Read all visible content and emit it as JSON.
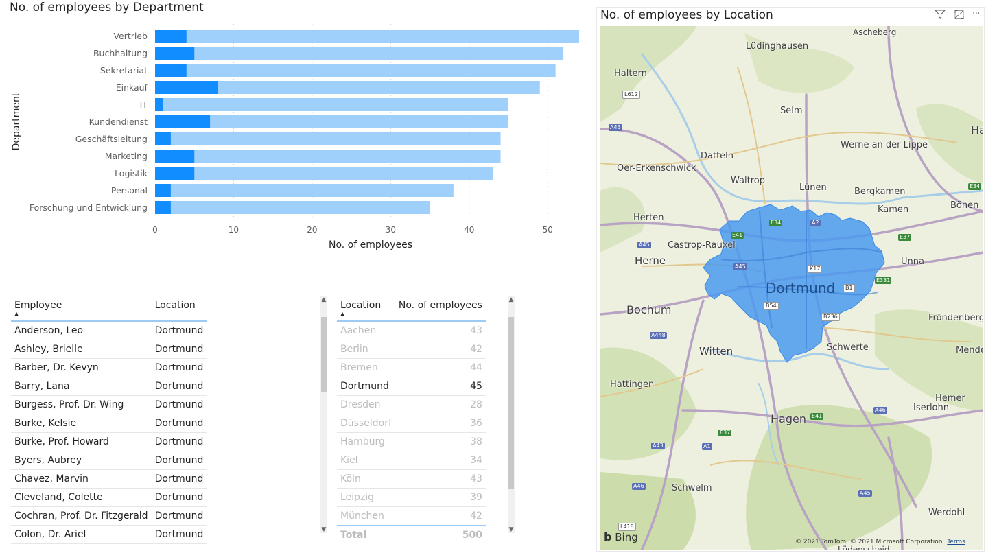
{
  "bar_visual": {
    "title": "No. of employees by Department"
  },
  "chart_data": {
    "type": "bar",
    "orientation": "horizontal",
    "title": "No. of employees by Department",
    "xlabel": "No. of employees",
    "ylabel": "Department",
    "xlim": [
      0,
      55
    ],
    "x_ticks": [
      "0",
      "10",
      "20",
      "30",
      "40",
      "50"
    ],
    "grid": true,
    "categories": [
      "Vertrieb",
      "Buchhaltung",
      "Sekretariat",
      "Einkauf",
      "IT",
      "Kundendienst",
      "Geschäftsleitung",
      "Marketing",
      "Logistik",
      "Personal",
      "Forschung und Entwicklung"
    ],
    "series": [
      {
        "values": [
          54,
          52,
          51,
          49,
          45,
          45,
          44,
          44,
          43,
          38,
          35
        ],
        "color": "#9fd0fc"
      },
      {
        "values": [
          4,
          5,
          4,
          8,
          1,
          7,
          2,
          5,
          5,
          2,
          2
        ],
        "color": "#118dff"
      }
    ]
  },
  "employee_table": {
    "headers": {
      "employee": "Employee",
      "location": "Location"
    },
    "sort_arrow": "▲",
    "rows": [
      [
        "Anderson, Leo",
        "Dortmund"
      ],
      [
        "Ashley, Brielle",
        "Dortmund"
      ],
      [
        "Barber, Dr. Kevyn",
        "Dortmund"
      ],
      [
        "Barry, Lana",
        "Dortmund"
      ],
      [
        "Burgess, Prof. Dr. Wing",
        "Dortmund"
      ],
      [
        "Burke, Kelsie",
        "Dortmund"
      ],
      [
        "Burke, Prof. Howard",
        "Dortmund"
      ],
      [
        "Byers, Aubrey",
        "Dortmund"
      ],
      [
        "Chavez, Marvin",
        "Dortmund"
      ],
      [
        "Cleveland, Colette",
        "Dortmund"
      ],
      [
        "Cochran, Prof. Dr. Fitzgerald",
        "Dortmund"
      ],
      [
        "Colon, Dr. Ariel",
        "Dortmund"
      ]
    ]
  },
  "location_table": {
    "headers": {
      "location": "Location",
      "count": "No. of employees"
    },
    "sort_arrow": "▲",
    "rows": [
      [
        "Aachen",
        "43",
        false
      ],
      [
        "Berlin",
        "42",
        false
      ],
      [
        "Bremen",
        "44",
        false
      ],
      [
        "Dortmund",
        "45",
        true
      ],
      [
        "Dresden",
        "28",
        false
      ],
      [
        "Düsseldorf",
        "36",
        false
      ],
      [
        "Hamburg",
        "38",
        false
      ],
      [
        "Kiel",
        "34",
        false
      ],
      [
        "Köln",
        "43",
        false
      ],
      [
        "Leipzig",
        "39",
        false
      ],
      [
        "München",
        "42",
        false
      ]
    ],
    "total_label": "Total",
    "total_value": "500"
  },
  "map_visual": {
    "title": "No. of employees by Location",
    "selected_city": "Dortmund",
    "highlight_color": "#4a9af0",
    "places": [
      "Ascheberg",
      "Lüdinghausen",
      "Haltern",
      "Selm",
      "Werne an der Lippe",
      "Datteln",
      "Oer-Erkenschwick",
      "Waltrop",
      "Lünen",
      "Bergkamen",
      "Bönen",
      "Kamen",
      "Herten",
      "Castrop-Rauxel",
      "Herne",
      "Unna",
      "Bochum",
      "Fröndenberg",
      "Witten",
      "Schwerte",
      "Mende",
      "Hattingen",
      "Hemer",
      "Iserlohn",
      "Hagen",
      "Schwelm",
      "Werdohl",
      "Ha",
      "Lüdenscheid"
    ],
    "road_labels": [
      "L612",
      "A43",
      "E34",
      "E37",
      "A45",
      "A45",
      "K17",
      "B1",
      "E331",
      "B54",
      "B236",
      "A448",
      "E41",
      "A46",
      "E37",
      "A43",
      "A1",
      "A46",
      "A45",
      "L418",
      "E41",
      "E34",
      "A2"
    ],
    "bing_label": "Bing",
    "copyright": "© 2021 TomTom, © 2021 Microsoft Corporation",
    "terms_label": "Terms",
    "icons": {
      "filter": "filter-icon",
      "focus": "focus-mode-icon",
      "more": "more-options-icon"
    }
  }
}
